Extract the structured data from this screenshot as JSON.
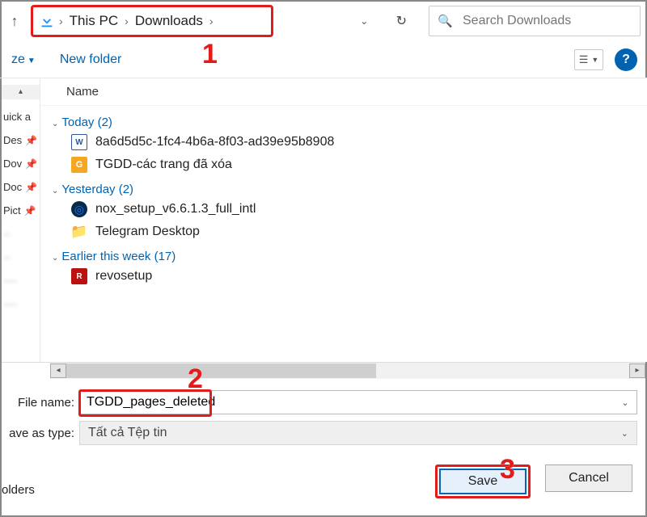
{
  "breadcrumb": {
    "root": "This PC",
    "folder": "Downloads"
  },
  "search": {
    "placeholder": "Search Downloads"
  },
  "toolbar": {
    "organize": "ze",
    "newfolder": "New folder"
  },
  "columns": {
    "name": "Name"
  },
  "sidebar": {
    "items": [
      "uick a",
      "Des",
      "Dov",
      "Doc",
      "Pict"
    ]
  },
  "groups": [
    {
      "label": "Today (2)",
      "items": [
        {
          "icon": "word",
          "text": "8a6d5d5c-1fc4-4b6a-8f03-ad39e95b8908"
        },
        {
          "icon": "foxit",
          "text": "TGDD-các trang đã xóa"
        }
      ]
    },
    {
      "label": "Yesterday (2)",
      "items": [
        {
          "icon": "nox",
          "text": "nox_setup_v6.6.1.3_full_intl"
        },
        {
          "icon": "folder",
          "text": "Telegram Desktop"
        }
      ]
    },
    {
      "label": "Earlier this week (17)",
      "items": [
        {
          "icon": "revo",
          "text": "revosetup"
        }
      ]
    }
  ],
  "fields": {
    "filename_label": "File name:",
    "filename_value": "TGDD_pages_deleted",
    "saveas_label": "ave as type:",
    "saveas_value": "Tất cả Tệp tin"
  },
  "buttons": {
    "folders": "olders",
    "save": "Save",
    "cancel": "Cancel"
  },
  "annotations": {
    "a1": "1",
    "a2": "2",
    "a3": "3"
  }
}
